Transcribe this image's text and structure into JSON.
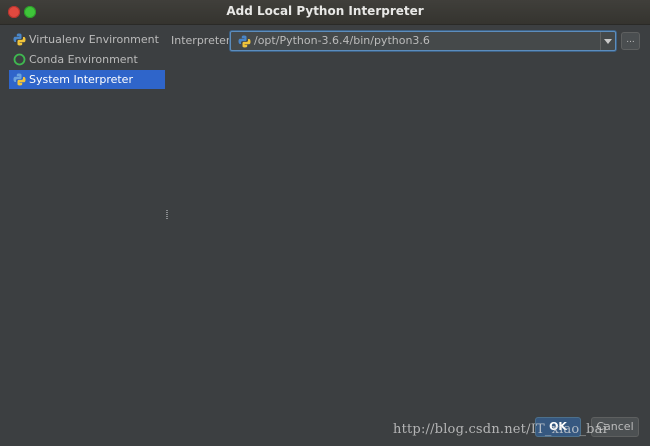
{
  "window": {
    "title": "Add Local Python Interpreter"
  },
  "sidebar": {
    "items": [
      {
        "label": "Virtualenv Environment",
        "icon": "python-icon",
        "selected": false
      },
      {
        "label": "Conda Environment",
        "icon": "conda-circle-icon",
        "selected": false
      },
      {
        "label": "System Interpreter",
        "icon": "python-icon",
        "selected": true
      }
    ]
  },
  "main": {
    "interpreter_label": "Interpreter:",
    "interpreter_value": "/opt/Python-3.6.4/bin/python3.6",
    "browse_label": "..."
  },
  "footer": {
    "ok_label": "OK",
    "cancel_label": "Cancel"
  },
  "watermark": "http://blog.csdn.net/IT_xiao_bai",
  "colors": {
    "background": "#3c3f41",
    "selection": "#2f65ca",
    "text": "#bbbbbb",
    "focus_border": "#5c8dbd",
    "ok_button": "#365880",
    "close_button": "#e2493f",
    "maximize_button": "#3fc43a",
    "conda_ring": "#3fb950"
  }
}
